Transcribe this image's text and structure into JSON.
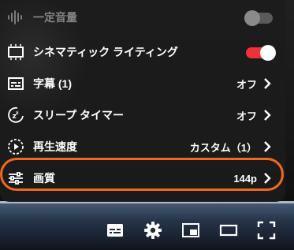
{
  "menu": {
    "items": [
      {
        "id": "stable-volume",
        "label": "一定音量",
        "icon": "stable-volume-icon",
        "control": "toggle",
        "state": "off"
      },
      {
        "id": "ambient-mode",
        "label": "シネマティック ライティング",
        "icon": "ambient-mode-icon",
        "control": "toggle",
        "state": "on"
      },
      {
        "id": "subtitles",
        "label": "字幕",
        "label_count": "(1)",
        "icon": "subtitles-icon",
        "value": "オフ"
      },
      {
        "id": "sleep-timer",
        "label": "スリープ タイマー",
        "icon": "sleep-timer-icon",
        "value": "オフ"
      },
      {
        "id": "playback-speed",
        "label": "再生速度",
        "icon": "playback-speed-icon",
        "value": "カスタム（1）"
      },
      {
        "id": "quality",
        "label": "画質",
        "icon": "quality-sliders-icon",
        "value": "144p"
      }
    ]
  },
  "colors": {
    "toggle_on": "#f2303a",
    "highlight": "#f2691b",
    "panel": "#1c1c1c"
  },
  "controls": [
    {
      "id": "subtitles-button",
      "icon": "subtitles-icon"
    },
    {
      "id": "settings-button",
      "icon": "gear-icon"
    },
    {
      "id": "miniplayer-button",
      "icon": "miniplayer-icon"
    },
    {
      "id": "theater-button",
      "icon": "theater-mode-icon"
    },
    {
      "id": "fullscreen-button",
      "icon": "fullscreen-icon"
    }
  ]
}
